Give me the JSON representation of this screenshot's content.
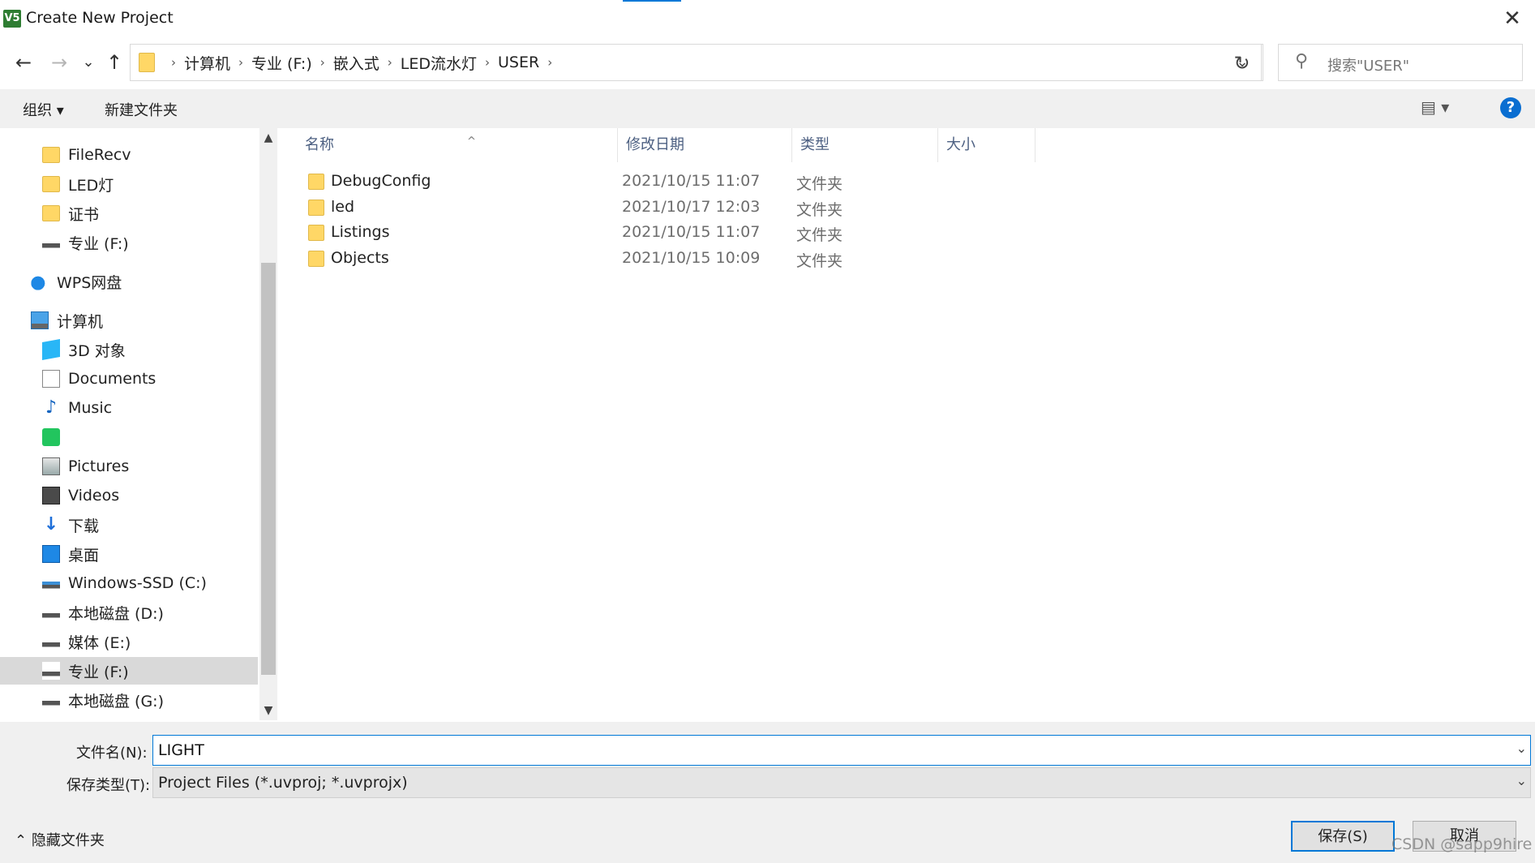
{
  "window": {
    "title": "Create New Project",
    "app_icon": "V5",
    "close_glyph": "✕"
  },
  "nav": {
    "back": "←",
    "forward": "→",
    "recent": "⌄",
    "up": "↑",
    "breadcrumbs": [
      "计算机",
      "专业 (F:)",
      "嵌入式",
      "LED流水灯",
      "USER"
    ],
    "refresh": "↻",
    "search_placeholder": "搜索\"USER\""
  },
  "toolbar": {
    "organize": "组织 ▾",
    "new_folder": "新建文件夹",
    "view": "▤ ▾",
    "help": "?"
  },
  "sidebar": {
    "items": [
      {
        "label": "FileRecv",
        "icon": "folder-icon"
      },
      {
        "label": "LED灯",
        "icon": "folder-icon"
      },
      {
        "label": "证书",
        "icon": "folder-icon"
      },
      {
        "label": "专业 (F:)",
        "icon": "drive-icon"
      },
      {
        "label": "WPS网盘",
        "icon": "cloud-icon"
      },
      {
        "label": "计算机",
        "icon": "computer-icon"
      },
      {
        "label": "3D 对象",
        "icon": "3d-objects-icon"
      },
      {
        "label": "Documents",
        "icon": "documents-icon"
      },
      {
        "label": "Music",
        "icon": "music-icon"
      },
      {
        "label": "",
        "icon": "app-shortcut-icon"
      },
      {
        "label": "Pictures",
        "icon": "pictures-icon"
      },
      {
        "label": "Videos",
        "icon": "videos-icon"
      },
      {
        "label": "下载",
        "icon": "download-icon"
      },
      {
        "label": "桌面",
        "icon": "desktop-icon"
      },
      {
        "label": "Windows-SSD (C:)",
        "icon": "ssd-drive-icon"
      },
      {
        "label": "本地磁盘 (D:)",
        "icon": "drive-icon"
      },
      {
        "label": "媒体 (E:)",
        "icon": "drive-icon"
      },
      {
        "label": "专业 (F:)",
        "icon": "drive-icon"
      },
      {
        "label": "本地磁盘 (G:)",
        "icon": "drive-icon"
      }
    ],
    "selected_index": 17
  },
  "columns": {
    "name": "名称",
    "date": "修改日期",
    "type": "类型",
    "size": "大小"
  },
  "files": [
    {
      "name": "DebugConfig",
      "date": "2021/10/15 11:07",
      "type": "文件夹"
    },
    {
      "name": "led",
      "date": "2021/10/17 12:03",
      "type": "文件夹"
    },
    {
      "name": "Listings",
      "date": "2021/10/15 11:07",
      "type": "文件夹"
    },
    {
      "name": "Objects",
      "date": "2021/10/15 10:09",
      "type": "文件夹"
    }
  ],
  "form": {
    "filename_label": "文件名(N):",
    "filename_value": "LIGHT",
    "filetype_label": "保存类型(T):",
    "filetype_value": "Project Files (*.uvproj; *.uvprojx)"
  },
  "footer": {
    "hide_folders": "隐藏文件夹",
    "save": "保存(S)",
    "cancel": "取消",
    "watermark": "CSDN @sapp9hire"
  }
}
